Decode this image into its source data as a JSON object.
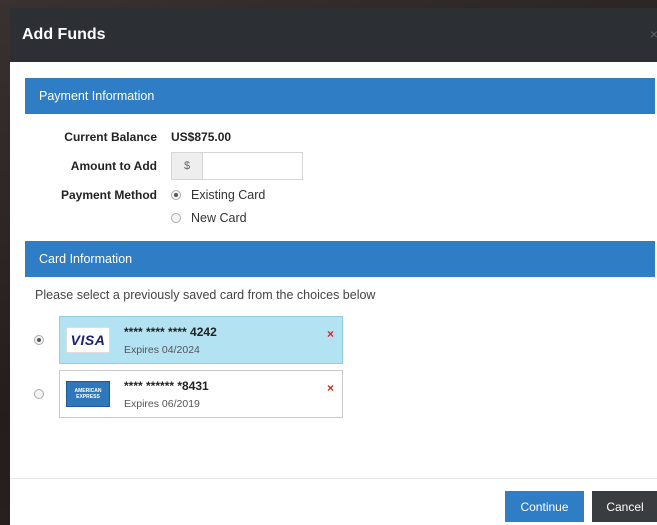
{
  "modal": {
    "title": "Add Funds",
    "close_label": "×"
  },
  "payment_info": {
    "heading": "Payment Information",
    "current_balance_label": "Current Balance",
    "current_balance_value": "US$875.00",
    "amount_label": "Amount to Add",
    "amount_prefix": "$",
    "amount_value": "",
    "method_label": "Payment Method",
    "methods": [
      {
        "label": "Existing Card",
        "selected": true
      },
      {
        "label": "New Card",
        "selected": false
      }
    ]
  },
  "card_info": {
    "heading": "Card Information",
    "instructions": "Please select a previously saved card from the choices below",
    "cards": [
      {
        "brand": "VISA",
        "number": "**** **** **** 4242",
        "expires": "Expires 04/2024",
        "selected": true,
        "remove": "×"
      },
      {
        "brand": "AMERICAN EXPRESS",
        "number": "**** ****** *8431",
        "expires": "Expires 06/2019",
        "selected": false,
        "remove": "×"
      }
    ]
  },
  "footer": {
    "continue_label": "Continue",
    "cancel_label": "Cancel"
  },
  "colors": {
    "header_bg": "#2c2f33",
    "accent": "#2f7dc4",
    "selected_card_bg": "#b3e2f3",
    "remove": "#d9261c"
  }
}
